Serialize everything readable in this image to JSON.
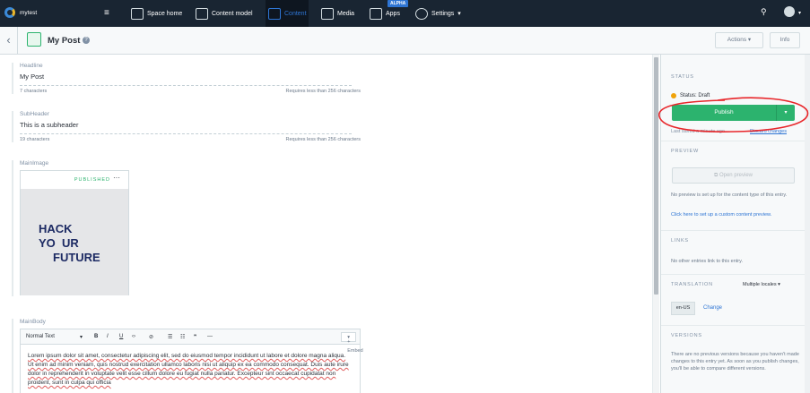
{
  "topbar": {
    "space_name": "mytest",
    "nav": [
      {
        "label": "Space home",
        "icon": "home-icon"
      },
      {
        "label": "Content model",
        "icon": "content-model-icon"
      },
      {
        "label": "Content",
        "icon": "content-icon"
      },
      {
        "label": "Media",
        "icon": "media-icon"
      },
      {
        "label": "Apps",
        "icon": "apps-icon",
        "badge": "ALPHA"
      },
      {
        "label": "Settings",
        "icon": "gear-icon"
      }
    ],
    "active_nav": "Content"
  },
  "subbar": {
    "title": "My Post",
    "actions_label": "Actions",
    "info_label": "Info"
  },
  "fields": {
    "headline": {
      "label": "Headline",
      "value": "My Post",
      "count": "7 characters",
      "hint": "Requires less than 256 characters"
    },
    "subheader": {
      "label": "SubHeader",
      "value": "This is a subheader",
      "count": "19 characters",
      "hint": "Requires less than 256 characters"
    },
    "mainimage": {
      "label": "MainImage",
      "status": "PUBLISHED",
      "image_text_lines": [
        "HACK",
        "YO  UR",
        "FUTURE"
      ]
    },
    "mainbody": {
      "label": "MainBody",
      "toolbar": {
        "format": "Normal Text",
        "embed": "+ Embed"
      },
      "text": "Lorem ipsum dolor sit amet, consectetur adipiscing elit, sed do eiusmod tempor incididunt ut labore et dolore magna aliqua. Ut enim ad minim veniam, quis nostrud exercitation ullamco laboris nisi ut aliquip ex ea commodo consequat. Duis aute irure dolor in reprehenderit in voluptate velit esse cillum dolore eu fugiat nulla pariatur. Excepteur sint occaecat cupidatat non proident, sunt in culpa qui officia"
    }
  },
  "sidebar": {
    "status_head": "STATUS",
    "status_text": "Status: Draft",
    "publish_label": "Publish",
    "last_saved": "Last saved a minute ago",
    "discard_label": "Discard changes",
    "preview_head": "PREVIEW",
    "open_preview": "Open preview",
    "no_preview": "No preview is set up for the content type of this entry.",
    "setup_preview_link": "Click here to set up a custom content preview.",
    "links_head": "LINKS",
    "no_links": "No other entries link to this entry.",
    "translation_head": "TRANSLATION",
    "translation_mode": "Multiple locales",
    "locale": "en-US",
    "change_label": "Change",
    "versions_head": "VERSIONS",
    "versions_text": "There are no previous versions because you haven't made changes to this entry yet. As soon as you publish changes, you'll be able to compare different versions."
  },
  "colors": {
    "accent_green": "#2cb36e",
    "nav_bg": "#192532",
    "link_blue": "#2e75d4",
    "annotation_red": "#e8262a"
  }
}
